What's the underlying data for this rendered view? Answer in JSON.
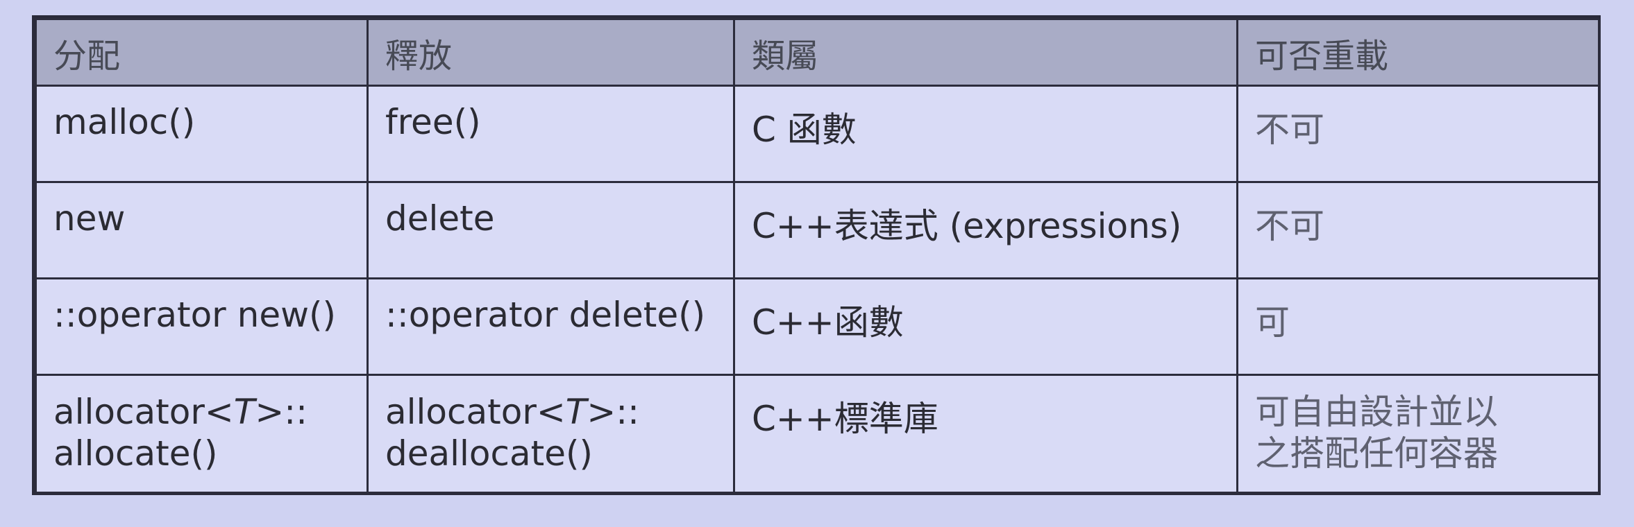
{
  "table": {
    "headers": [
      "分配",
      "釋放",
      "類屬",
      "可否重載"
    ],
    "rows": [
      {
        "alloc": "malloc()",
        "release": "free()",
        "category": "C 函數",
        "overload": "不可"
      },
      {
        "alloc": "new",
        "release": "delete",
        "category": "C++表達式 (expressions)",
        "overload": "不可"
      },
      {
        "alloc": "::operator new()",
        "release": "::operator delete()",
        "category": "C++函數",
        "overload": "可"
      },
      {
        "alloc_prefix": "allocator<",
        "alloc_tparam": "T",
        "alloc_suffix": ">::",
        "alloc_line2": "allocate()",
        "release_prefix": "allocator<",
        "release_tparam": "T",
        "release_suffix": ">::",
        "release_line2": "deallocate()",
        "category": "C++標準庫",
        "overload_line1": "可自由設計並以",
        "overload_line2": "之搭配任何容器"
      }
    ]
  }
}
